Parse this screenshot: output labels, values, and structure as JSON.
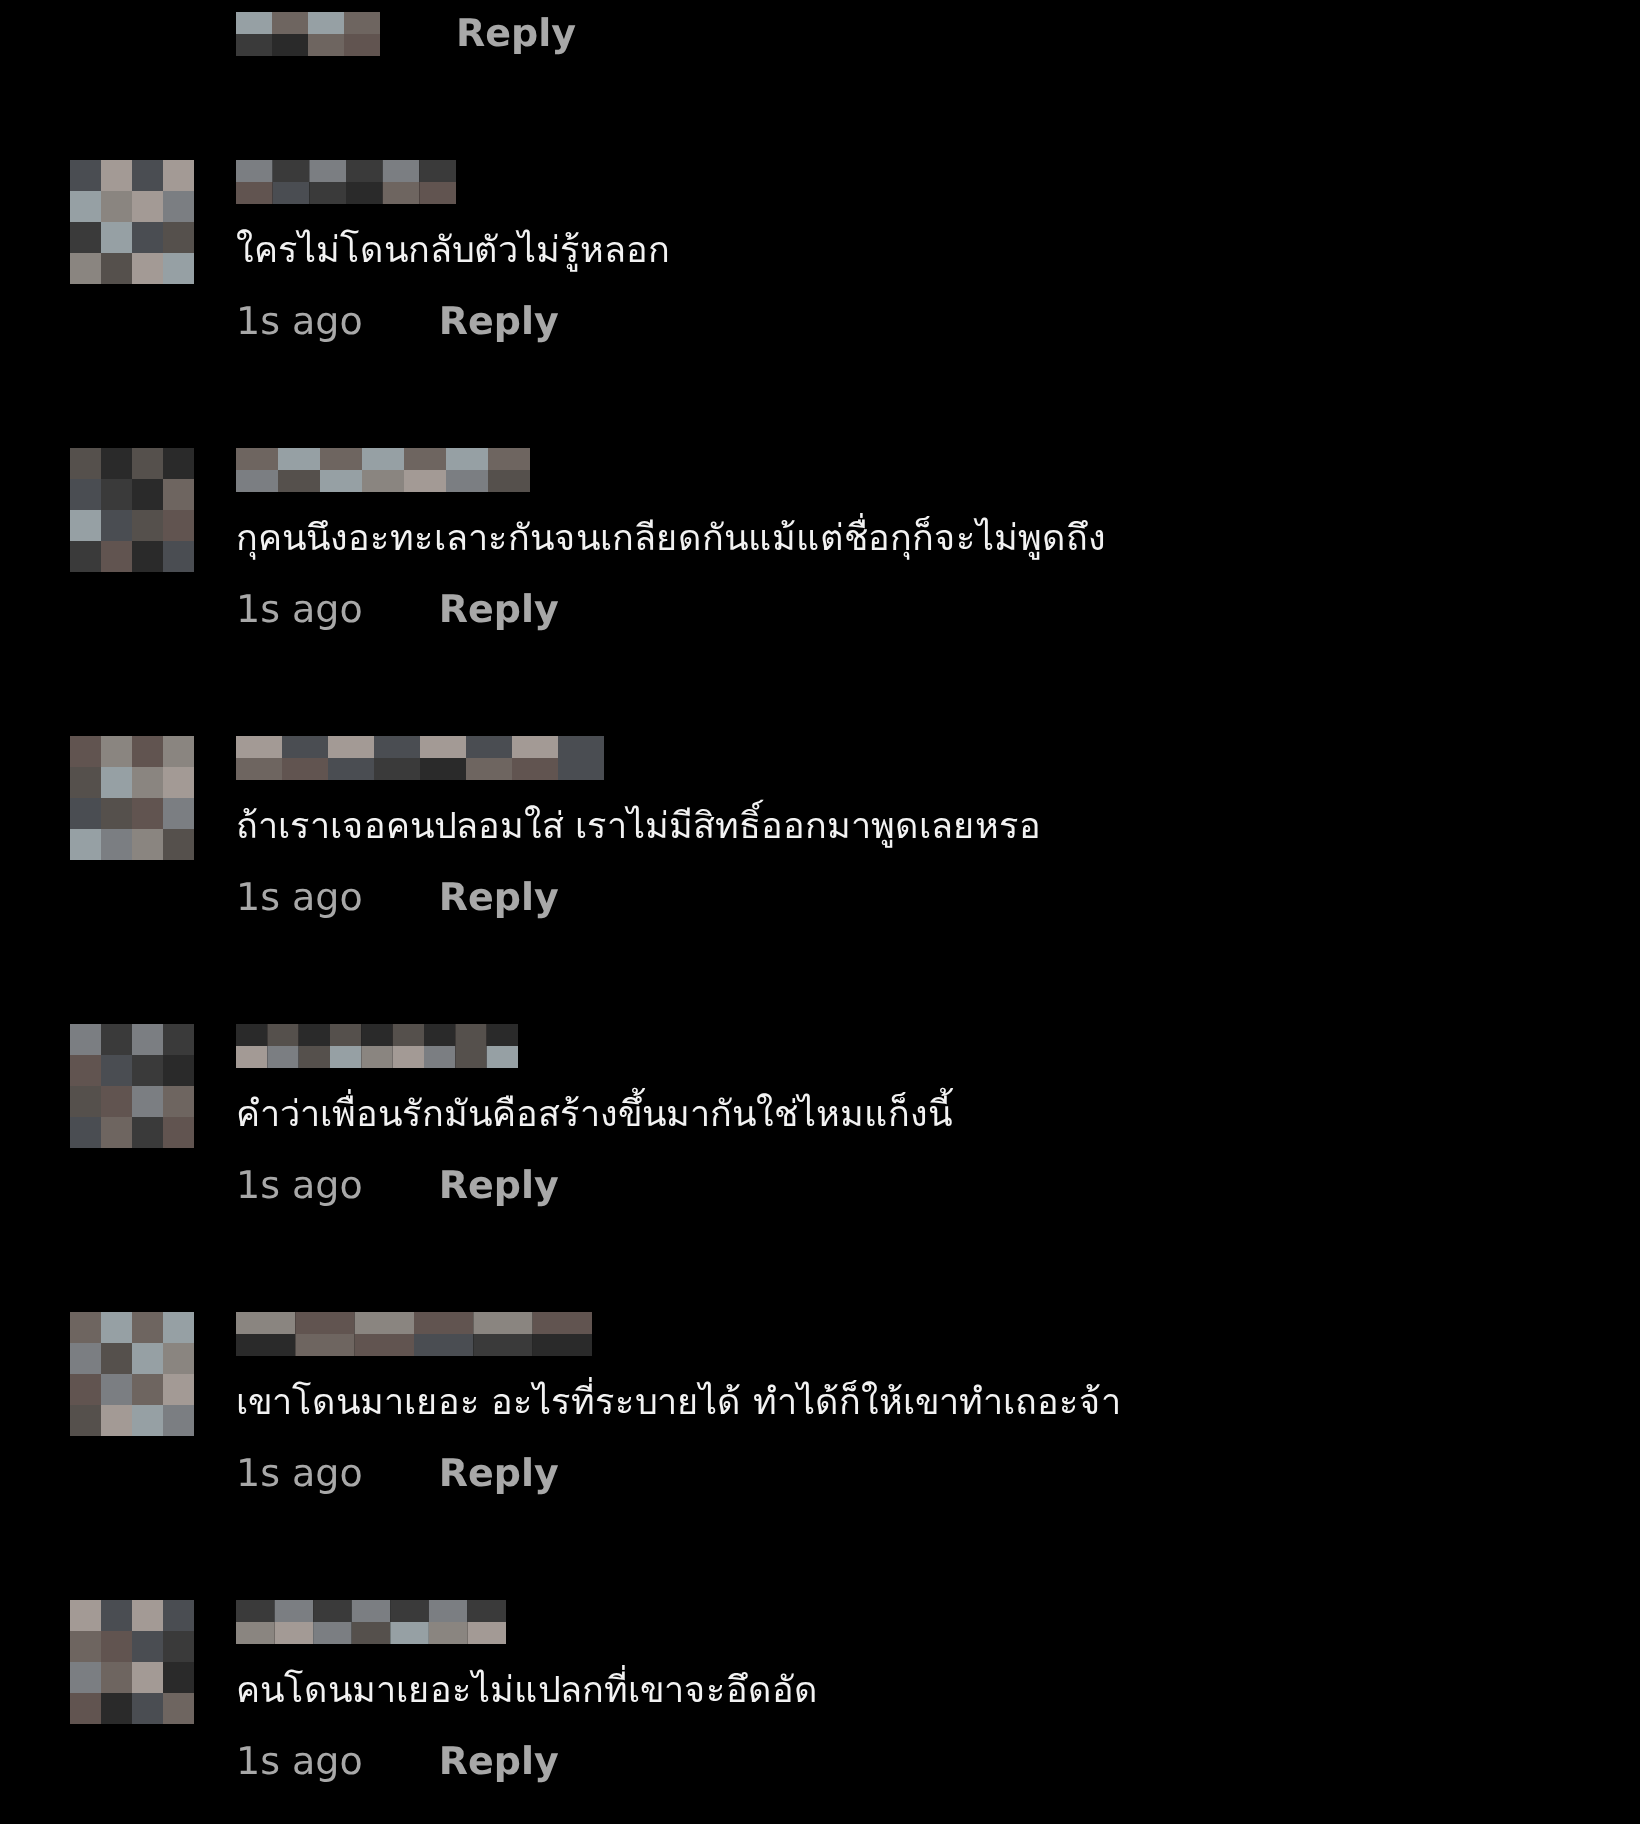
{
  "top_partial": {
    "reply": "Reply"
  },
  "comments": [
    {
      "text": "ใครไม่โดนกลับตัวไม่รู้หลอก",
      "time": "1s ago",
      "reply": "Reply"
    },
    {
      "text": "กุคนนึงอะทะเลาะกันจนเกลียดกันแม้แต่ชื่อกุก็จะไม่พูดถึง",
      "time": "1s ago",
      "reply": "Reply"
    },
    {
      "text": "ถ้าเราเจอคนปลอมใส่ เราไม่มีสิทธิ์ออกมาพูดเลยหรอ",
      "time": "1s ago",
      "reply": "Reply"
    },
    {
      "text": "คำว่าเพื่อนรักมันคือสร้างขึ้นมากันใช่ไหมแก็งนี้",
      "time": "1s ago",
      "reply": "Reply"
    },
    {
      "text": "เขาโดนมาเยอะ อะไรที่ระบายได้ ทำได้ก็ให้เขาทำเถอะจ้า",
      "time": "1s ago",
      "reply": "Reply"
    },
    {
      "text": "คนโดนมาเยอะไม่แปลกที่เขาจะอึดอัด",
      "time": "1s ago",
      "reply": "Reply"
    }
  ]
}
